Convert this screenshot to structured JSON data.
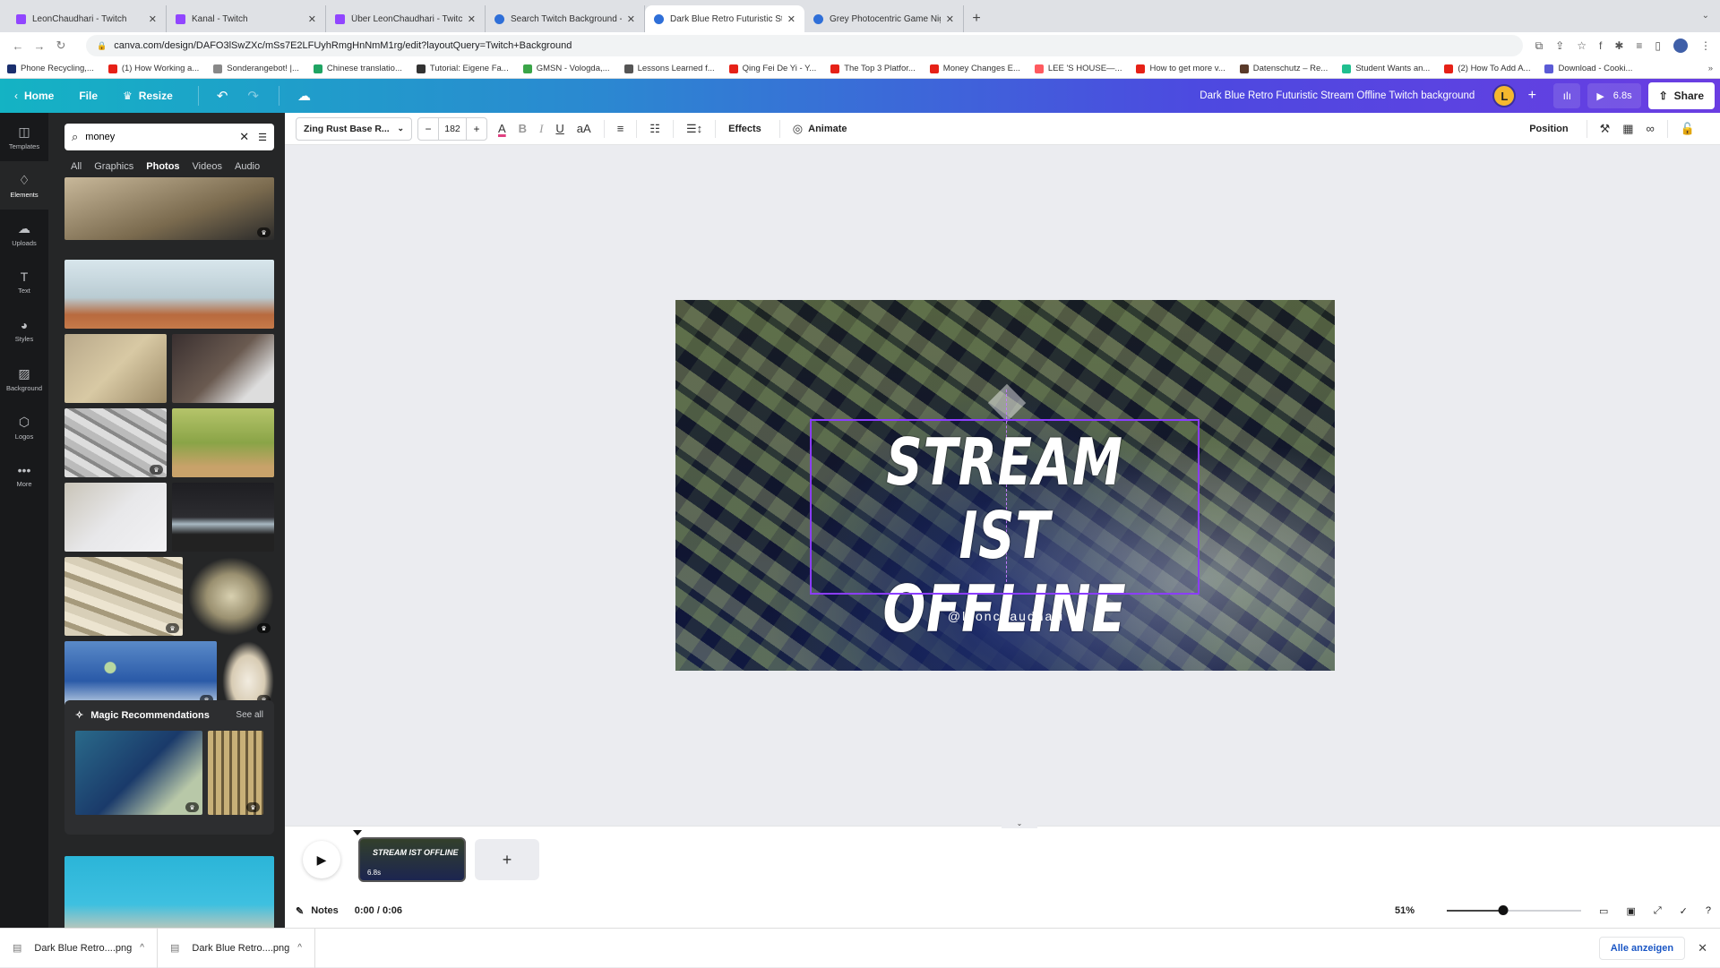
{
  "browser": {
    "tabs": [
      {
        "label": "LeonChaudhari - Twitch",
        "favicon": "twitch-icon",
        "active": false
      },
      {
        "label": "Kanal - Twitch",
        "favicon": "twitch-icon",
        "active": false
      },
      {
        "label": "Über LeonChaudhari - Twitch",
        "favicon": "twitch-icon",
        "active": false
      },
      {
        "label": "Search Twitch Background - C",
        "favicon": "canva-icon",
        "active": false
      },
      {
        "label": "Dark Blue Retro Futuristic Stre",
        "favicon": "canva-icon",
        "active": true
      },
      {
        "label": "Grey Photocentric Game Night",
        "favicon": "canva-icon",
        "active": false
      }
    ],
    "url": "canva.com/design/DAFO3lSwZXc/mSs7E2LFUyhRmgHnNmM1rg/edit?layoutQuery=Twitch+Background",
    "bookmarks": [
      {
        "label": "Phone Recycling,...",
        "color": "#1a2f6e"
      },
      {
        "label": "(1) How Working a...",
        "color": "#e62117"
      },
      {
        "label": "Sonderangebot! |...",
        "color": "#888888"
      },
      {
        "label": "Chinese translatio...",
        "color": "#1fa463"
      },
      {
        "label": "Tutorial: Eigene Fa...",
        "color": "#333333"
      },
      {
        "label": "GMSN - Vologda,...",
        "color": "#3aa548"
      },
      {
        "label": "Lessons Learned f...",
        "color": "#555555"
      },
      {
        "label": "Qing Fei De Yi - Y...",
        "color": "#e62117"
      },
      {
        "label": "The Top 3 Platfor...",
        "color": "#e62117"
      },
      {
        "label": "Money Changes E...",
        "color": "#e62117"
      },
      {
        "label": "LEE 'S HOUSE—...",
        "color": "#ff5a5f"
      },
      {
        "label": "How to get more v...",
        "color": "#e62117"
      },
      {
        "label": "Datenschutz – Re...",
        "color": "#5a3a2a"
      },
      {
        "label": "Student Wants an...",
        "color": "#1fbf8f"
      },
      {
        "label": "(2) How To Add A...",
        "color": "#e62117"
      },
      {
        "label": "Download - Cooki...",
        "color": "#5b5bd6"
      }
    ]
  },
  "header": {
    "home": "Home",
    "file": "File",
    "resize": "Resize",
    "doc_title": "Dark Blue Retro Futuristic Stream Offline Twitch background",
    "user_initial": "L",
    "duration": "6.8s",
    "share": "Share"
  },
  "rail": [
    {
      "label": "Templates",
      "icon": "templates-icon",
      "glyph": "◫",
      "active": false
    },
    {
      "label": "Elements",
      "icon": "elements-icon",
      "glyph": "♢",
      "active": true
    },
    {
      "label": "Uploads",
      "icon": "upload-cloud-icon",
      "glyph": "☁",
      "active": false
    },
    {
      "label": "Text",
      "icon": "text-icon",
      "glyph": "T",
      "active": false
    },
    {
      "label": "Styles",
      "icon": "palette-icon",
      "glyph": "◕",
      "active": false
    },
    {
      "label": "Background",
      "icon": "background-icon",
      "glyph": "▨",
      "active": false
    },
    {
      "label": "Logos",
      "icon": "logos-icon",
      "glyph": "⬡",
      "active": false
    },
    {
      "label": "More",
      "icon": "more-icon",
      "glyph": "•••",
      "active": false
    }
  ],
  "panel": {
    "search_value": "money",
    "filters": [
      "All",
      "Graphics",
      "Photos",
      "Videos",
      "Audio"
    ],
    "active_filter": "Photos",
    "magic_title": "Magic Recommendations",
    "see_all": "See all"
  },
  "toolbar": {
    "font": "Zing Rust Base R...",
    "font_size": "182",
    "effects": "Effects",
    "animate": "Animate",
    "position": "Position"
  },
  "design": {
    "headline_line1": "STREAM IST",
    "headline_line2": "OFFLINE",
    "handle": "@leonchaudhari"
  },
  "timeline": {
    "clip_title": "STREAM IST OFFLINE",
    "clip_duration": "6.8s",
    "notes": "Notes",
    "time": "0:00 / 0:06",
    "zoom_percent": "51%",
    "zoom_slider_fraction": 0.42
  },
  "downloads": {
    "files": [
      "Dark Blue Retro....png",
      "Dark Blue Retro....png"
    ],
    "show_all": "Alle anzeigen"
  }
}
